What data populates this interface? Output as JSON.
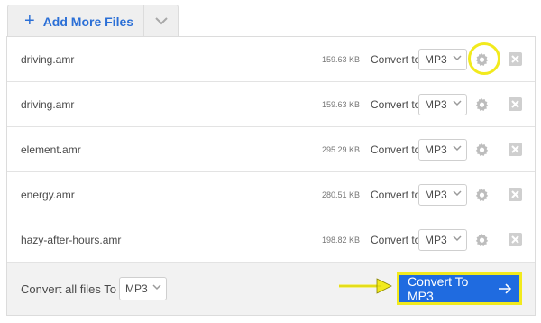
{
  "header": {
    "add_label": "Add More Files",
    "add_icon": "plus-icon",
    "dropdown_icon": "chevron-down-icon"
  },
  "files": [
    {
      "name": "driving.amr",
      "size": "159.63 KB",
      "convert_label": "Convert to",
      "format": "MP3",
      "highlighted": true
    },
    {
      "name": "driving.amr",
      "size": "159.63 KB",
      "convert_label": "Convert to",
      "format": "MP3",
      "highlighted": false
    },
    {
      "name": "element.amr",
      "size": "295.29 KB",
      "convert_label": "Convert to",
      "format": "MP3",
      "highlighted": false
    },
    {
      "name": "energy.amr",
      "size": "280.51 KB",
      "convert_label": "Convert to",
      "format": "MP3",
      "highlighted": false
    },
    {
      "name": "hazy-after-hours.amr",
      "size": "198.82 KB",
      "convert_label": "Convert to",
      "format": "MP3",
      "highlighted": false
    }
  ],
  "footer": {
    "convert_all_label": "Convert all files To",
    "all_format": "MP3",
    "convert_button_label": "Convert To MP3",
    "convert_button_icon": "arrow-right-icon"
  },
  "colors": {
    "accent": "#1f6be0",
    "link": "#2b6fd6",
    "highlight": "#f2ea1d"
  }
}
